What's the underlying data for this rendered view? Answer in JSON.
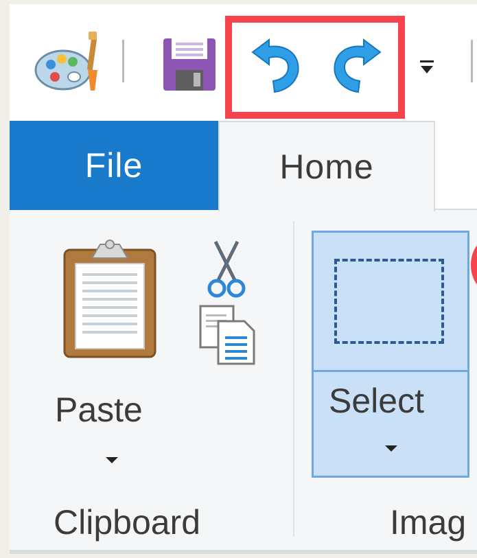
{
  "tabs": {
    "file": "File",
    "home": "Home"
  },
  "clipboard": {
    "paste_label": "Paste",
    "group_label": "Clipboard"
  },
  "image": {
    "select_label": "Select",
    "group_label": "Imag"
  },
  "icons": {
    "app": "paint-app-icon",
    "save": "save-icon",
    "undo": "undo-icon",
    "redo": "redo-icon",
    "customize": "customize-toolbar-icon",
    "paste": "clipboard-paste-icon",
    "cut": "scissors-cut-icon",
    "copy": "copy-icon",
    "select": "rectangle-select-icon"
  },
  "colors": {
    "file_tab": "#1979ca",
    "highlight": "#f6434c",
    "select_bg": "#c9e0f7",
    "select_border": "#6fa7de",
    "undo_redo": "#2e9fe6"
  }
}
